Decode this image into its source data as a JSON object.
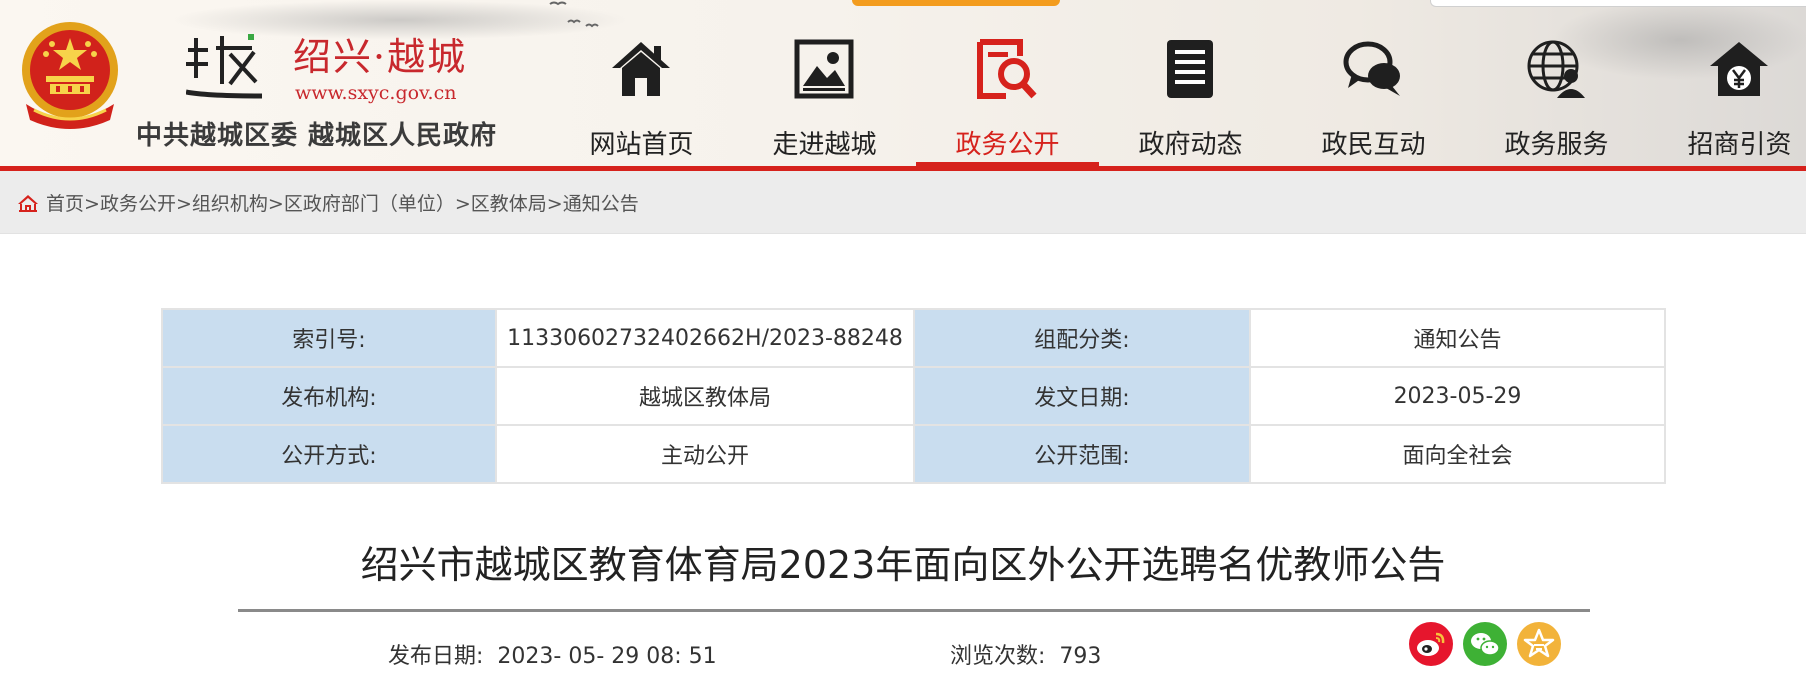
{
  "site": {
    "name": "绍兴·越城",
    "url": "www.sxyc.gov.cn",
    "full_name": "中共越城区委 越城区人民政府"
  },
  "nav": {
    "items": [
      {
        "label": "网站首页",
        "icon": "home-icon"
      },
      {
        "label": "走进越城",
        "icon": "picture-icon"
      },
      {
        "label": "政务公开",
        "icon": "magnify-document-icon",
        "active": true
      },
      {
        "label": "政府动态",
        "icon": "document-list-icon"
      },
      {
        "label": "政民互动",
        "icon": "chat-bubbles-icon"
      },
      {
        "label": "政务服务",
        "icon": "globe-user-icon"
      },
      {
        "label": "招商引资",
        "icon": "house-yen-icon"
      }
    ]
  },
  "breadcrumb": {
    "items": [
      "首页",
      "政务公开",
      "组织机构",
      "区政府部门（单位）",
      "区教体局",
      "通知公告"
    ],
    "separator": ">"
  },
  "info": {
    "rows": [
      {
        "k1": "索引号:",
        "v1": "11330602732402662H/2023-88248",
        "k2": "组配分类:",
        "v2": "通知公告"
      },
      {
        "k1": "发布机构:",
        "v1": "越城区教体局",
        "k2": "发文日期:",
        "v2": "2023-05-29"
      },
      {
        "k1": "公开方式:",
        "v1": "主动公开",
        "k2": "公开范围:",
        "v2": "面向全社会"
      }
    ]
  },
  "article": {
    "title": "绍兴市越城区教育体育局2023年面向区外公开选聘名优教师公告",
    "publish_label": "发布日期:",
    "publish_value": "2023- 05- 29 08: 51",
    "views_label": "浏览次数:",
    "views_value": "793"
  },
  "share": {
    "weibo_color": "#e6162d",
    "wechat_color": "#3eb135",
    "favorite_color": "#f2b33a"
  },
  "colors": {
    "accent_red": "#d6221c",
    "table_key_bg": "#c9ddef"
  }
}
